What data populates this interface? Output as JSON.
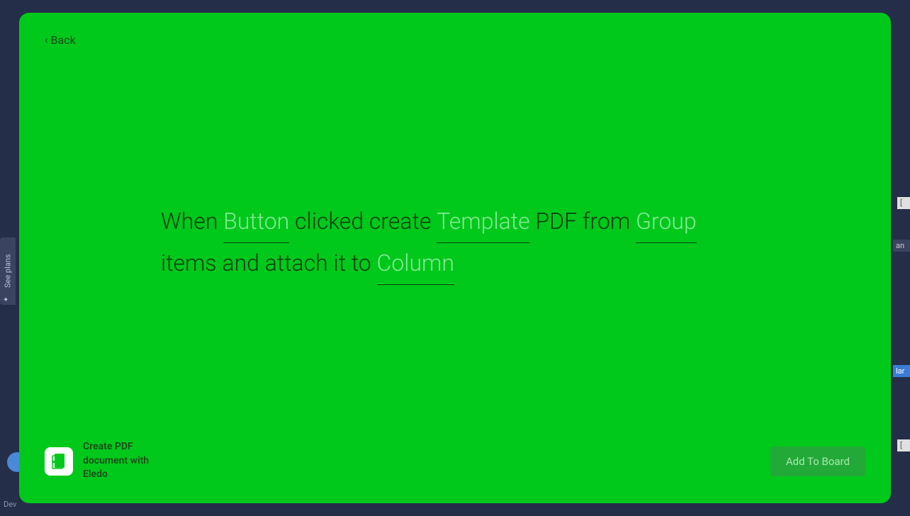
{
  "sidebar": {
    "seePlans": "See plans"
  },
  "bottom": {
    "devLabel": "Dev"
  },
  "rightEdge": {
    "item1": "[",
    "item2": "an",
    "item3": "lar",
    "item4": "["
  },
  "modal": {
    "backLabel": "Back",
    "sentence": {
      "part1": "When ",
      "placeholder1": "Button",
      "part2": " clicked create ",
      "placeholder2": "Template",
      "part3": " PDF from ",
      "placeholder3": "Group",
      "part4": " items and attach it to ",
      "placeholder4": "Column"
    },
    "footer": {
      "appTitle": "Create PDF document with Eledo",
      "addButton": "Add To Board"
    }
  }
}
